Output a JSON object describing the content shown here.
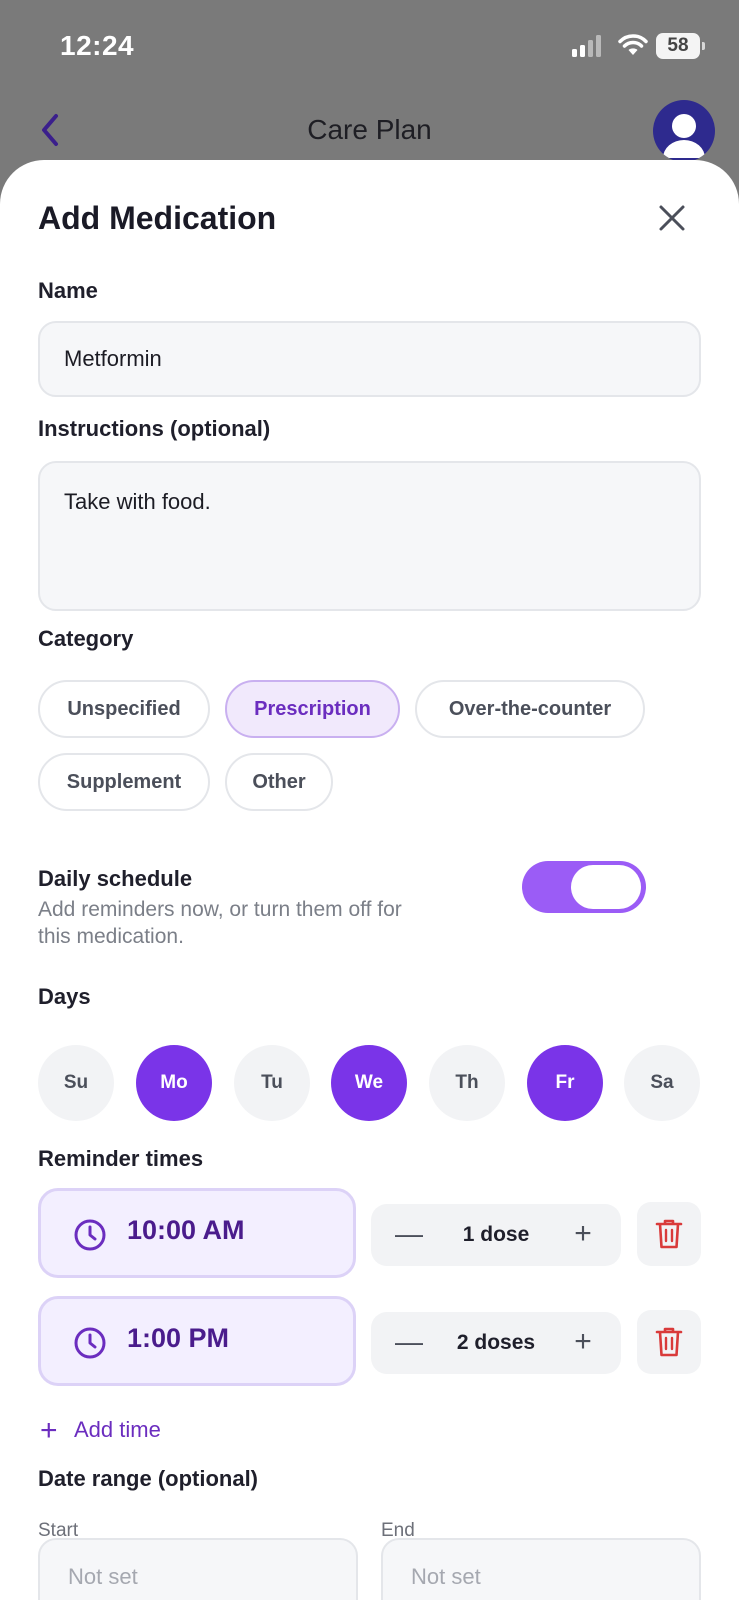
{
  "status_bar": {
    "time": "12:24",
    "battery": "58"
  },
  "nav": {
    "title": "Care Plan"
  },
  "sheet": {
    "title": "Add Medication",
    "name": {
      "label": "Name",
      "value": "Metformin"
    },
    "instructions": {
      "label": "Instructions (optional)",
      "value": "Take with food."
    },
    "category": {
      "label": "Category",
      "options": [
        "Unspecified",
        "Prescription",
        "Over-the-counter",
        "Supplement",
        "Other"
      ],
      "selected": "Prescription"
    },
    "schedule": {
      "title": "Daily schedule",
      "subtitle": "Add reminders now, or turn them off for this medication.",
      "enabled": true
    },
    "days": {
      "label": "Days",
      "items": [
        "Su",
        "Mo",
        "Tu",
        "We",
        "Th",
        "Fr",
        "Sa"
      ],
      "selected": [
        "Mo",
        "We",
        "Fr"
      ]
    },
    "reminders": {
      "label": "Reminder times",
      "items": [
        {
          "time": "10:00 AM",
          "dose": "1 dose"
        },
        {
          "time": "1:00 PM",
          "dose": "2 doses"
        }
      ],
      "add_label": "Add time"
    },
    "date_range": {
      "label": "Date range (optional)",
      "start_label": "Start",
      "end_label": "End",
      "start_value": "Not set",
      "end_value": "Not set"
    }
  },
  "colors": {
    "accent": "#7a34e8",
    "toggle": "#9b5cf6",
    "chip_selected_bg": "#f1e9fc",
    "danger": "#d93a3a"
  },
  "icons": [
    "back-chevron-icon",
    "avatar-icon",
    "close-icon",
    "clock-icon",
    "minus-icon",
    "plus-icon",
    "trash-icon"
  ]
}
